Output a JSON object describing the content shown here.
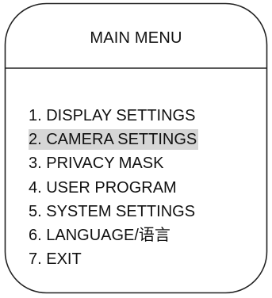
{
  "menu": {
    "title": "MAIN MENU",
    "selected_index": 1,
    "items": [
      {
        "label": "1. DISPLAY SETTINGS"
      },
      {
        "label": "2. CAMERA SETTINGS"
      },
      {
        "label": "3. PRIVACY MASK"
      },
      {
        "label": "4. USER PROGRAM"
      },
      {
        "label": "5. SYSTEM SETTINGS"
      },
      {
        "label": "6. LANGUAGE/语言"
      },
      {
        "label": "7. EXIT"
      }
    ]
  },
  "colors": {
    "frame_stroke": "#222222",
    "text": "#111111",
    "highlight": "#d6d6d6",
    "background": "#ffffff"
  }
}
